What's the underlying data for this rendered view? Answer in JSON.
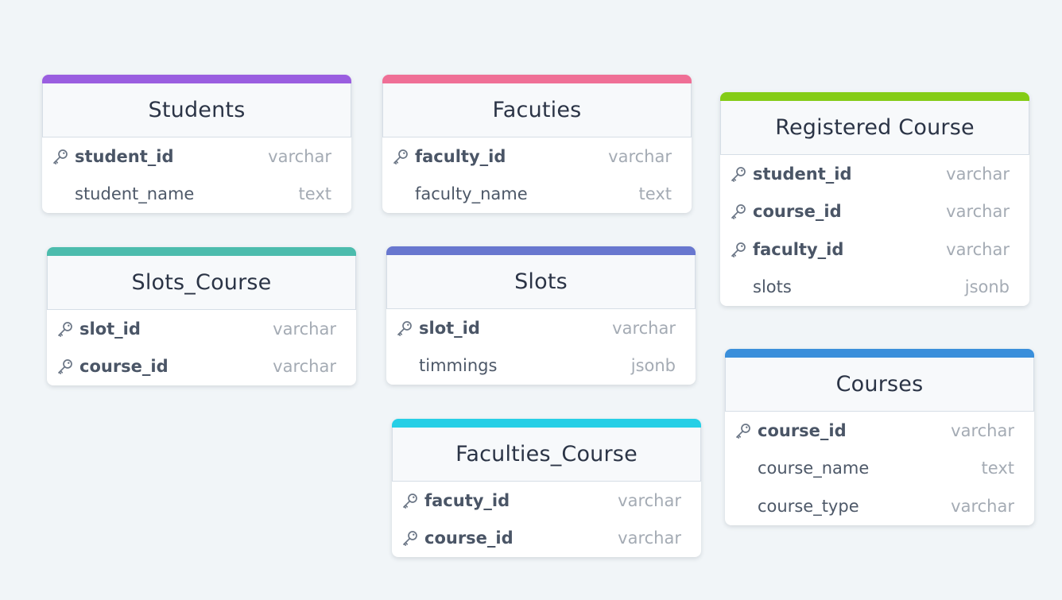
{
  "tables": [
    {
      "id": "students",
      "title": "Students",
      "color": "#9a5ee0",
      "columns": [
        {
          "name": "student_id",
          "type": "varchar",
          "pk": true
        },
        {
          "name": "student_name",
          "type": "text",
          "pk": false
        }
      ]
    },
    {
      "id": "facuties",
      "title": "Facuties",
      "color": "#ef6f96",
      "columns": [
        {
          "name": "faculty_id",
          "type": "varchar",
          "pk": true
        },
        {
          "name": "faculty_name",
          "type": "text",
          "pk": false
        }
      ]
    },
    {
      "id": "registered-course",
      "title": "Registered Course",
      "color": "#84cc16",
      "columns": [
        {
          "name": "student_id",
          "type": "varchar",
          "pk": true
        },
        {
          "name": "course_id",
          "type": "varchar",
          "pk": true
        },
        {
          "name": "faculty_id",
          "type": "varchar",
          "pk": true
        },
        {
          "name": "slots",
          "type": "jsonb",
          "pk": false
        }
      ]
    },
    {
      "id": "slots-course",
      "title": "Slots_Course",
      "color": "#4cbcad",
      "columns": [
        {
          "name": "slot_id",
          "type": "varchar",
          "pk": true
        },
        {
          "name": "course_id",
          "type": "varchar",
          "pk": true
        }
      ]
    },
    {
      "id": "slots",
      "title": "Slots",
      "color": "#6877cf",
      "columns": [
        {
          "name": "slot_id",
          "type": "varchar",
          "pk": true
        },
        {
          "name": "timmings",
          "type": "jsonb",
          "pk": false
        }
      ]
    },
    {
      "id": "courses",
      "title": "Courses",
      "color": "#3a8fdb",
      "columns": [
        {
          "name": "course_id",
          "type": "varchar",
          "pk": true
        },
        {
          "name": "course_name",
          "type": "text",
          "pk": false
        },
        {
          "name": "course_type",
          "type": "varchar",
          "pk": false
        }
      ]
    },
    {
      "id": "faculties-course",
      "title": "Faculties_Course",
      "color": "#26cfe6",
      "columns": [
        {
          "name": "facuty_id",
          "type": "varchar",
          "pk": true
        },
        {
          "name": "course_id",
          "type": "varchar",
          "pk": true
        }
      ]
    }
  ],
  "icons": {
    "primary_key": "key-icon"
  }
}
